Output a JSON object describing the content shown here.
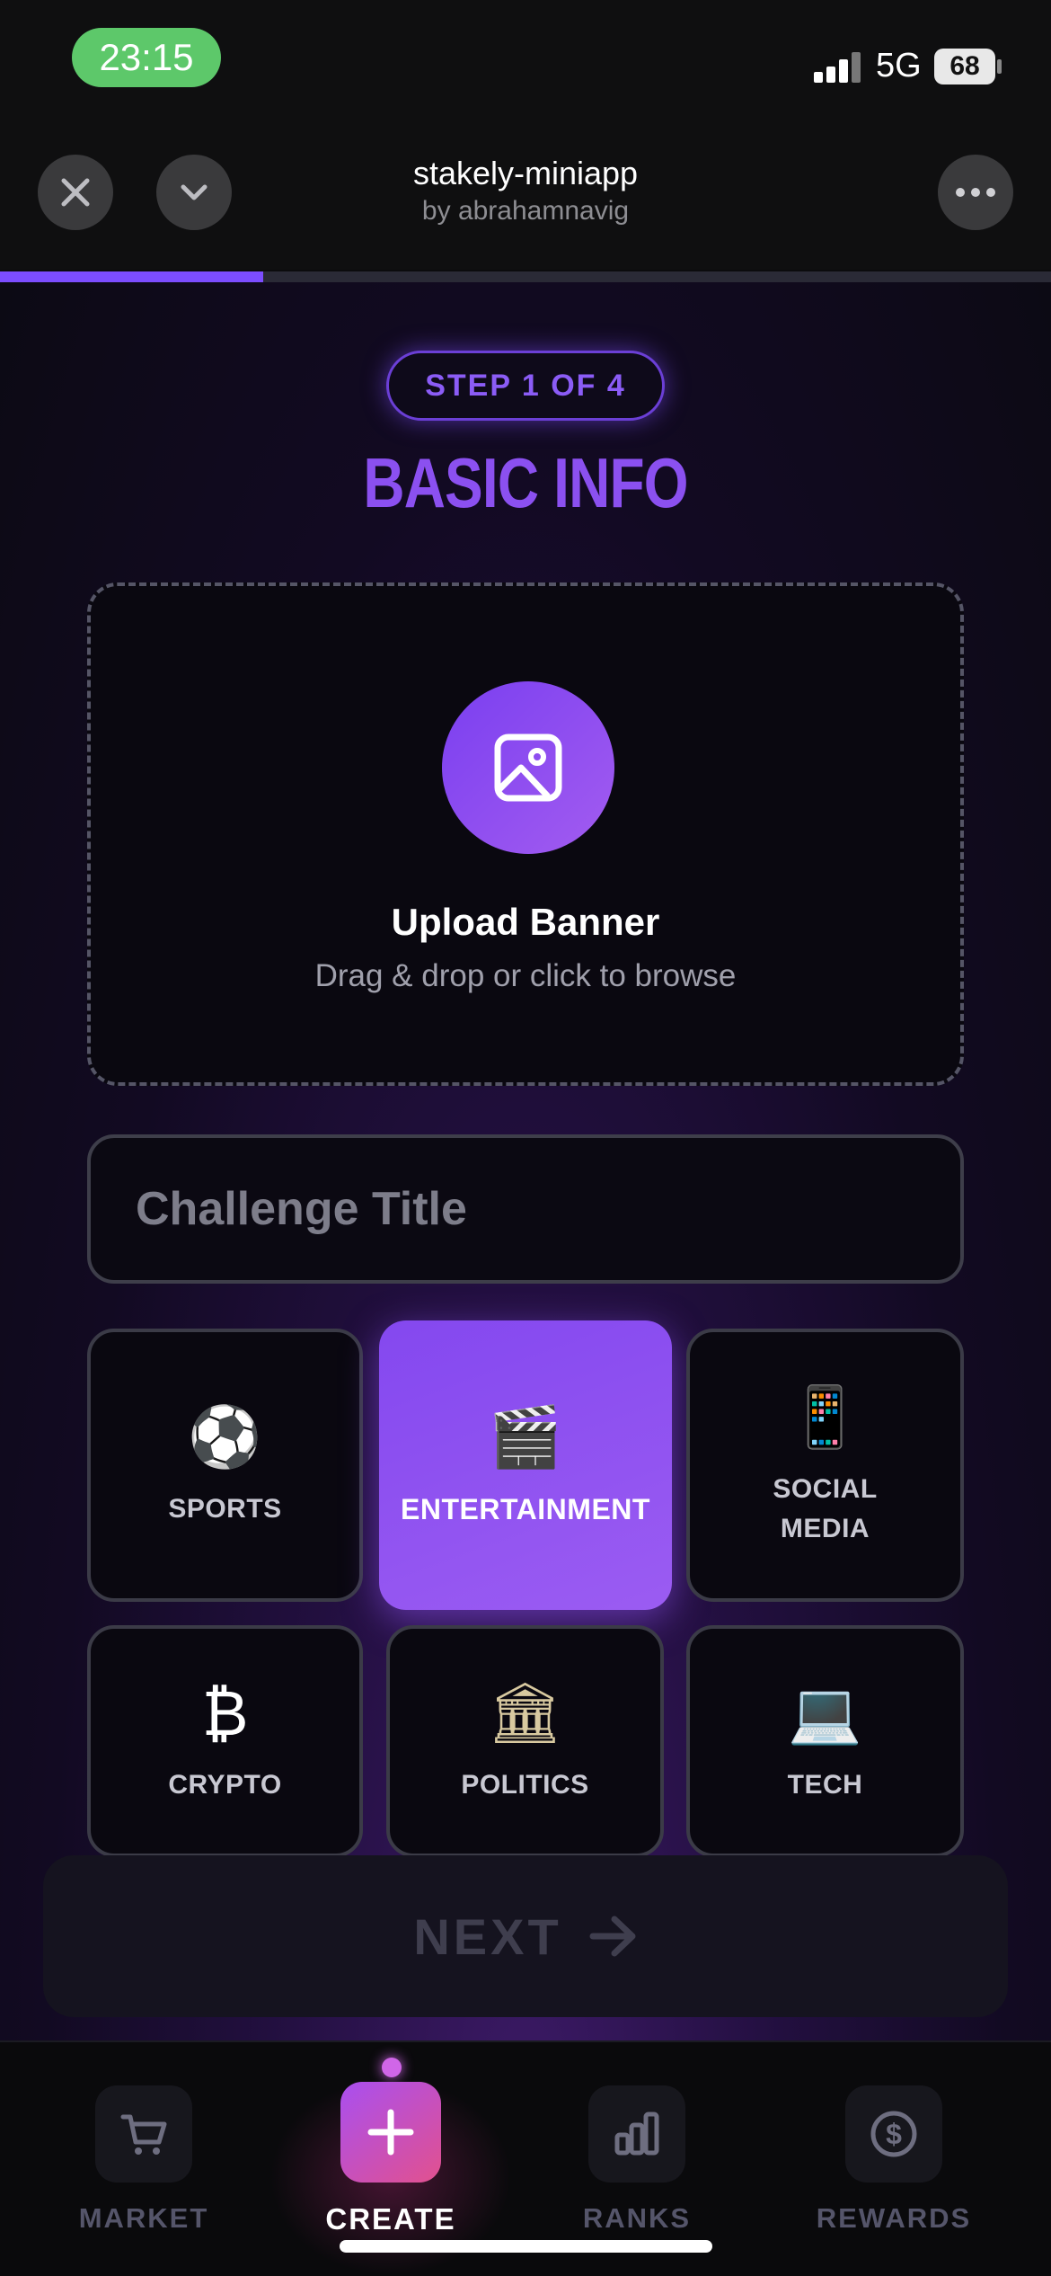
{
  "status_bar": {
    "time": "23:15",
    "network": "5G",
    "battery": "68"
  },
  "header": {
    "title": "stakely-miniapp",
    "subtitle": "by abrahamnavig"
  },
  "progress": {
    "fraction": 0.25
  },
  "step": {
    "label": "STEP 1 OF 4",
    "title": "BASIC INFO"
  },
  "upload": {
    "title": "Upload Banner",
    "subtitle": "Drag & drop or click to browse"
  },
  "title_input": {
    "placeholder": "Challenge Title",
    "value": ""
  },
  "categories": [
    {
      "id": "sports",
      "label": "SPORTS",
      "icon": "⚽",
      "selected": false
    },
    {
      "id": "entertainment",
      "label": "ENTERTAINMENT",
      "icon": "🎬",
      "selected": true
    },
    {
      "id": "social-media",
      "label": "SOCIAL MEDIA",
      "icon": "📱",
      "selected": false
    },
    {
      "id": "crypto",
      "label": "CRYPTO",
      "icon": "₿",
      "selected": false
    },
    {
      "id": "politics",
      "label": "POLITICS",
      "icon": "🏛",
      "selected": false
    },
    {
      "id": "tech",
      "label": "TECH",
      "icon": "💻",
      "selected": false
    }
  ],
  "next_button": {
    "label": "NEXT",
    "enabled": false
  },
  "nav": [
    {
      "id": "market",
      "label": "MARKET",
      "icon": "cart-icon",
      "active": false
    },
    {
      "id": "create",
      "label": "CREATE",
      "icon": "plus-icon",
      "active": true
    },
    {
      "id": "ranks",
      "label": "RANKS",
      "icon": "bar-chart-icon",
      "active": false
    },
    {
      "id": "rewards",
      "label": "REWARDS",
      "icon": "dollar-coin-icon",
      "active": false
    }
  ],
  "colors": {
    "accent": "#8b50f0",
    "accent_gradient_end": "#e2518e",
    "status_pill": "#5dc86a"
  }
}
